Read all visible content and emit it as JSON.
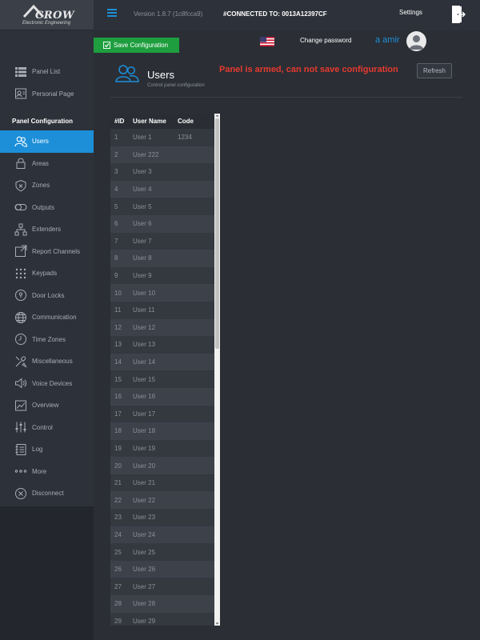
{
  "header": {
    "version": "Version 1.8.7 (1c8fcca9)",
    "connected": "#CONNECTED TO: 0013A12397CF",
    "settings_label": "Settings",
    "change_password_label": "Change password",
    "username": "a amir"
  },
  "logo": {
    "name": "CROW",
    "subtitle": "Electronic Engineering"
  },
  "toolbar": {
    "save_label": "Save Configuration"
  },
  "sidebar": {
    "top_items": [
      {
        "label": "Panel List",
        "icon": "list-icon"
      },
      {
        "label": "Personal Page",
        "icon": "personal-page-icon"
      }
    ],
    "section_title": "Panel Configuration",
    "config_items": [
      {
        "label": "Users",
        "icon": "users-icon",
        "active": true
      },
      {
        "label": "Areas",
        "icon": "lock-icon"
      },
      {
        "label": "Zones",
        "icon": "shield-icon"
      },
      {
        "label": "Outputs",
        "icon": "toggle-icon"
      },
      {
        "label": "Extenders",
        "icon": "sitemap-icon"
      },
      {
        "label": "Report Channels",
        "icon": "report-icon"
      },
      {
        "label": "Keypads",
        "icon": "keypad-icon"
      },
      {
        "label": "Door Locks",
        "icon": "door-lock-icon"
      },
      {
        "label": "Communication",
        "icon": "globe-icon"
      },
      {
        "label": "Time Zones",
        "icon": "clock-icon"
      },
      {
        "label": "Miscellaneous",
        "icon": "tools-icon"
      },
      {
        "label": "Voice Devices",
        "icon": "speaker-icon"
      },
      {
        "label": "Overview",
        "icon": "chart-icon"
      },
      {
        "label": "Control",
        "icon": "sliders-icon"
      },
      {
        "label": "Log",
        "icon": "log-icon"
      },
      {
        "label": "More",
        "icon": "more-icon"
      },
      {
        "label": "Disconnect",
        "icon": "close-icon"
      }
    ]
  },
  "page": {
    "title": "Users",
    "subtitle": "Control panel configuration",
    "warning": "Panel is armed, can not save configuration",
    "refresh_label": "Refresh"
  },
  "table": {
    "columns": [
      "#ID",
      "User Name",
      "Code"
    ],
    "rows": [
      [
        "1",
        "User 1",
        "1234"
      ],
      [
        "2",
        "User 222",
        ""
      ],
      [
        "3",
        "User 3",
        ""
      ],
      [
        "4",
        "User 4",
        ""
      ],
      [
        "5",
        "User 5",
        ""
      ],
      [
        "6",
        "User 6",
        ""
      ],
      [
        "7",
        "User 7",
        ""
      ],
      [
        "8",
        "User 8",
        ""
      ],
      [
        "9",
        "User 9",
        ""
      ],
      [
        "10",
        "User 10",
        ""
      ],
      [
        "11",
        "User 11",
        ""
      ],
      [
        "12",
        "User 12",
        ""
      ],
      [
        "13",
        "User 13",
        ""
      ],
      [
        "14",
        "User 14",
        ""
      ],
      [
        "15",
        "User 15",
        ""
      ],
      [
        "16",
        "User 16",
        ""
      ],
      [
        "17",
        "User 17",
        ""
      ],
      [
        "18",
        "User 18",
        ""
      ],
      [
        "19",
        "User 19",
        ""
      ],
      [
        "20",
        "User 20",
        ""
      ],
      [
        "21",
        "User 21",
        ""
      ],
      [
        "22",
        "User 22",
        ""
      ],
      [
        "23",
        "User 23",
        ""
      ],
      [
        "24",
        "User 24",
        ""
      ],
      [
        "25",
        "User 25",
        ""
      ],
      [
        "26",
        "User 26",
        ""
      ],
      [
        "27",
        "User 27",
        ""
      ],
      [
        "28",
        "User 28",
        ""
      ],
      [
        "29",
        "User 29",
        ""
      ]
    ]
  },
  "colors": {
    "accent": "#1d8fd9",
    "save": "#1e9e3e",
    "warning": "#e53a2f"
  }
}
